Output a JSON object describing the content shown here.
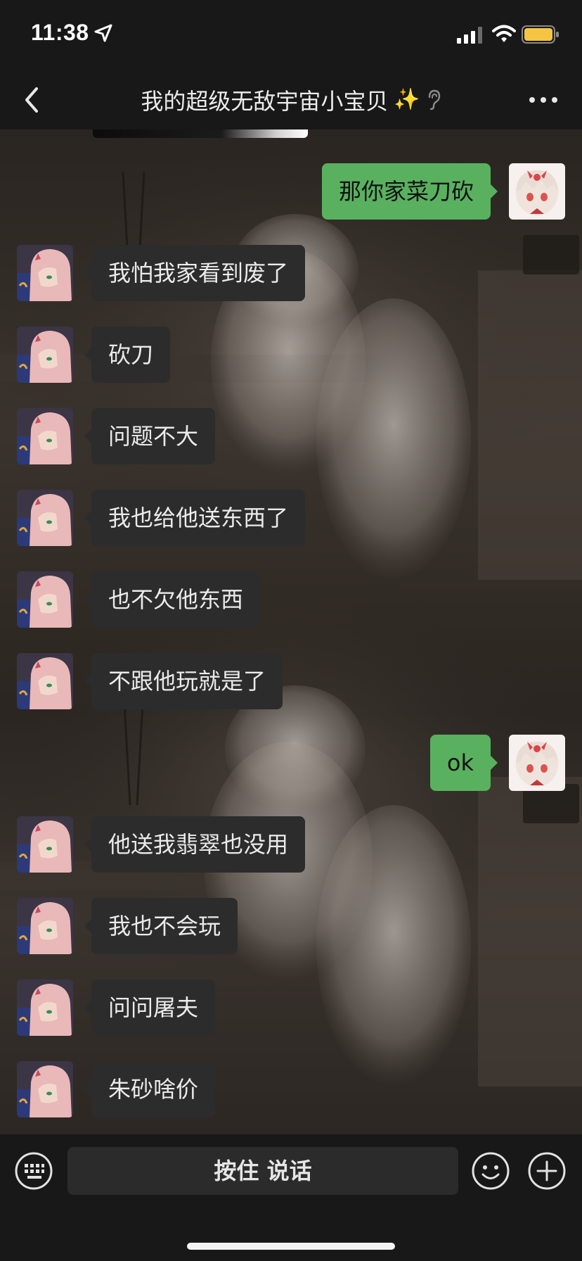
{
  "status_bar": {
    "time": "11:38",
    "battery_color": "#f4c542"
  },
  "nav": {
    "title": "我的超级无敌宇宙小宝贝",
    "title_emoji": "✨",
    "icons": [
      "chevron-left-icon",
      "sparkles-icon",
      "ear-icon",
      "more-dots-icon"
    ]
  },
  "messages": [
    {
      "side": "right",
      "text": "那你家菜刀砍",
      "avatar": "anime-girl-white-hair"
    },
    {
      "side": "left",
      "text": "我怕我家看到废了",
      "avatar": "anime-girl-pink-hair"
    },
    {
      "side": "left",
      "text": "砍刀",
      "avatar": "anime-girl-pink-hair"
    },
    {
      "side": "left",
      "text": "问题不大",
      "avatar": "anime-girl-pink-hair"
    },
    {
      "side": "left",
      "text": "我也给他送东西了",
      "avatar": "anime-girl-pink-hair"
    },
    {
      "side": "left",
      "text": "也不欠他东西",
      "avatar": "anime-girl-pink-hair"
    },
    {
      "side": "left",
      "text": "不跟他玩就是了",
      "avatar": "anime-girl-pink-hair"
    },
    {
      "side": "right",
      "text": "ok",
      "avatar": "anime-girl-white-hair"
    },
    {
      "side": "left",
      "text": "他送我翡翠也没用",
      "avatar": "anime-girl-pink-hair"
    },
    {
      "side": "left",
      "text": "我也不会玩",
      "avatar": "anime-girl-pink-hair"
    },
    {
      "side": "left",
      "text": "问问屠夫",
      "avatar": "anime-girl-pink-hair"
    },
    {
      "side": "left",
      "text": "朱砂啥价",
      "avatar": "anime-girl-pink-hair"
    }
  ],
  "input_bar": {
    "hold_to_talk_label": "按住 说话",
    "icons": [
      "keyboard-icon",
      "emoji-icon",
      "plus-icon"
    ]
  },
  "colors": {
    "outgoing_bubble": "#59b15f",
    "incoming_bubble": "#2c2c2c",
    "bar_background": "#181818"
  }
}
